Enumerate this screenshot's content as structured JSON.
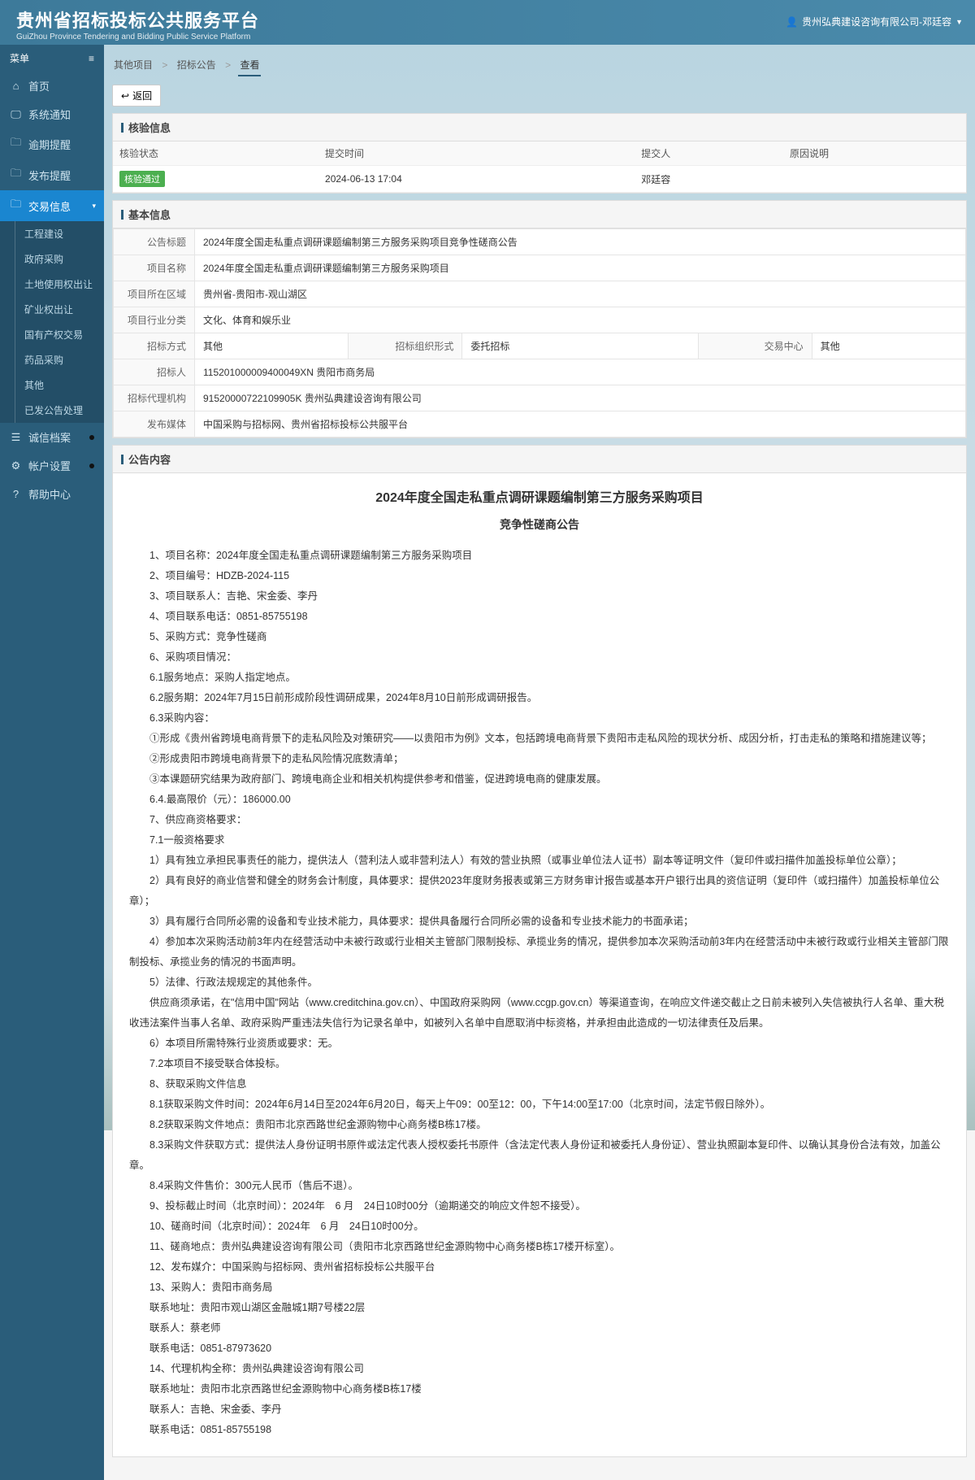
{
  "header": {
    "title": "贵州省招标投标公共服务平台",
    "subtitle": "GuiZhou Province Tendering and Bidding Public Service Platform",
    "user": "贵州弘典建设咨询有限公司-邓廷容"
  },
  "sidebar": {
    "menu_label": "菜单",
    "items": [
      {
        "icon": "⌂",
        "label": "首页"
      },
      {
        "icon": "🖵",
        "label": "系统通知"
      },
      {
        "icon": "🗀",
        "label": "逾期提醒"
      },
      {
        "icon": "🗀",
        "label": "发布提醒"
      },
      {
        "icon": "🗀",
        "label": "交易信息",
        "active": true,
        "chev": "▾"
      },
      {
        "icon": "☰",
        "label": "诚信档案",
        "dot": true
      },
      {
        "icon": "⚙",
        "label": "帐户设置",
        "dot": true
      },
      {
        "icon": "?",
        "label": "帮助中心"
      }
    ],
    "sub": [
      "工程建设",
      "政府采购",
      "土地使用权出让",
      "矿业权出让",
      "国有产权交易",
      "药品采购",
      "其他",
      "已发公告处理"
    ]
  },
  "breadcrumb": [
    "其他项目",
    "招标公告",
    "查看"
  ],
  "back_label": "返回",
  "panels": {
    "verify_title": "核验信息",
    "basic_title": "基本信息",
    "content_title": "公告内容"
  },
  "verify": {
    "headers": [
      "核验状态",
      "提交时间",
      "提交人",
      "原因说明"
    ],
    "row": {
      "status": "核验通过",
      "time": "2024-06-13 17:04",
      "person": "邓廷容",
      "reason": ""
    }
  },
  "basic": {
    "r1_l": "公告标题",
    "r1_v": "2024年度全国走私重点调研课题编制第三方服务采购项目竞争性磋商公告",
    "r2_l": "项目名称",
    "r2_v": "2024年度全国走私重点调研课题编制第三方服务采购项目",
    "r3_l": "项目所在区域",
    "r3_v": "贵州省-贵阳市-观山湖区",
    "r4_l": "项目行业分类",
    "r4_v": "文化、体育和娱乐业",
    "r5_l1": "招标方式",
    "r5_v1": "其他",
    "r5_l2": "招标组织形式",
    "r5_v2": "委托招标",
    "r5_l3": "交易中心",
    "r5_v3": "其他",
    "r6_l": "招标人",
    "r6_v": "115201000009400049XN 贵阳市商务局",
    "r7_l": "招标代理机构",
    "r7_v": "91520000722109905K 贵州弘典建设咨询有限公司",
    "r8_l": "发布媒体",
    "r8_v": "中国采购与招标网、贵州省招标投标公共服平台"
  },
  "content": {
    "title": "2024年度全国走私重点调研课题编制第三方服务采购项目",
    "subtitle": "竞争性磋商公告",
    "lines": [
      "1、项目名称：2024年度全国走私重点调研课题编制第三方服务采购项目",
      "2、项目编号：HDZB-2024-115",
      "3、项目联系人：吉艳、宋金委、李丹",
      "4、项目联系电话：0851-85755198",
      "5、采购方式：竞争性磋商",
      "6、采购项目情况：",
      "6.1服务地点：采购人指定地点。",
      "6.2服务期：2024年7月15日前形成阶段性调研成果，2024年8月10日前形成调研报告。",
      "6.3采购内容：",
      "①形成《贵州省跨境电商背景下的走私风险及对策研究——以贵阳市为例》文本，包括跨境电商背景下贵阳市走私风险的现状分析、成因分析，打击走私的策略和措施建议等；",
      "②形成贵阳市跨境电商背景下的走私风险情况底数清单；",
      "③本课题研究结果为政府部门、跨境电商企业和相关机构提供参考和借鉴，促进跨境电商的健康发展。",
      "6.4.最高限价（元）：186000.00",
      "7、供应商资格要求：",
      "7.1一般资格要求",
      "1）具有独立承担民事责任的能力，提供法人（营利法人或非营利法人）有效的营业执照（或事业单位法人证书）副本等证明文件（复印件或扫描件加盖投标单位公章）；",
      "2）具有良好的商业信誉和健全的财务会计制度，具体要求：提供2023年度财务报表或第三方财务审计报告或基本开户银行出具的资信证明（复印件（或扫描件）加盖投标单位公章）；",
      "3）具有履行合同所必需的设备和专业技术能力，具体要求：提供具备履行合同所必需的设备和专业技术能力的书面承诺；",
      "4）参加本次采购活动前3年内在经营活动中未被行政或行业相关主管部门限制投标、承揽业务的情况，提供参加本次采购活动前3年内在经营活动中未被行政或行业相关主管部门限制投标、承揽业务的情况的书面声明。",
      "5）法律、行政法规规定的其他条件。",
      "供应商须承诺，在\"信用中国\"网站（www.creditchina.gov.cn）、中国政府采购网（www.ccgp.gov.cn）等渠道查询，在响应文件递交截止之日前未被列入失信被执行人名单、重大税收违法案件当事人名单、政府采购严重违法失信行为记录名单中，如被列入名单中自愿取消中标资格，并承担由此造成的一切法律责任及后果。",
      "6）本项目所需特殊行业资质或要求：无。",
      "7.2本项目不接受联合体投标。",
      "8、获取采购文件信息",
      "8.1获取采购文件时间：2024年6月14日至2024年6月20日，每天上午09：00至12：00，下午14:00至17:00（北京时间，法定节假日除外）。",
      "8.2获取采购文件地点：贵阳市北京西路世纪金源购物中心商务楼B栋17楼。",
      "8.3采购文件获取方式：提供法人身份证明书原件或法定代表人授权委托书原件（含法定代表人身份证和被委托人身份证）、营业执照副本复印件、以确认其身份合法有效，加盖公章。",
      "8.4采购文件售价：300元人民币（售后不退）。",
      "9、投标截止时间（北京时间）：2024年　6 月　24日10时00分（逾期递交的响应文件恕不接受）。",
      "10、磋商时间（北京时间）：2024年　6 月　24日10时00分。",
      "11、磋商地点：贵州弘典建设咨询有限公司（贵阳市北京西路世纪金源购物中心商务楼B栋17楼开标室）。",
      "12、发布媒介：中国采购与招标网、贵州省招标投标公共服平台",
      "13、采购人：贵阳市商务局",
      "联系地址：贵阳市观山湖区金融城1期7号楼22层",
      "联系人：蔡老师",
      "联系电话：0851-87973620",
      "14、代理机构全称：贵州弘典建设咨询有限公司",
      "联系地址：贵阳市北京西路世纪金源购物中心商务楼B栋17楼",
      "联系人：吉艳、宋金委、李丹",
      "联系电话：0851-85755198"
    ]
  }
}
